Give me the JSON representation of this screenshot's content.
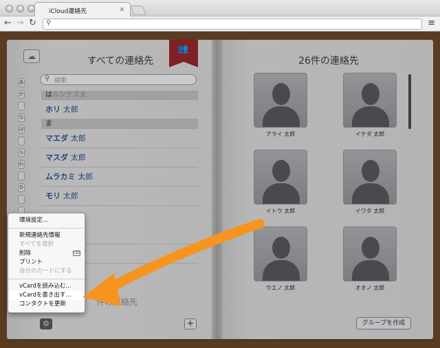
{
  "browser": {
    "tab_title": "iCloud連絡先"
  },
  "contacts_app": {
    "left_title": "すべての連絡先",
    "search_placeholder": "検索",
    "index_letters": [
      "あ",
      "か",
      "",
      "な",
      "は",
      "",
      "ら",
      "わ",
      "",
      "D",
      "",
      ""
    ],
    "sections": [
      {
        "header": "は",
        "header_rest": "ルンケス太",
        "contacts": [
          {
            "family": "ホリ",
            "given": "太郎"
          }
        ]
      },
      {
        "header": "ま",
        "header_rest": "",
        "contacts": [
          {
            "family": "マエダ",
            "given": "太郎"
          },
          {
            "family": "マスダ",
            "given": "太郎"
          },
          {
            "family": "ムラカミ",
            "given": "太郎"
          },
          {
            "family": "モリ",
            "given": "太郎"
          }
        ]
      }
    ],
    "footer_count": "件の連絡先",
    "right_title": "26件の連絡先",
    "cards": [
      {
        "name": "アライ 太郎"
      },
      {
        "name": "イケダ 太郎"
      },
      {
        "name": "イトウ 太郎"
      },
      {
        "name": "イワタ 太郎"
      },
      {
        "name": "ウエノ 太郎"
      },
      {
        "name": "オオノ 太郎"
      }
    ],
    "group_button": "グループを作成"
  },
  "context_menu": {
    "items": [
      {
        "label": "環境設定...",
        "enabled": true
      },
      {
        "label": "新規連絡先情報",
        "enabled": true
      },
      {
        "label": "すべてを選択",
        "enabled": false
      },
      {
        "label": "削除",
        "enabled": true
      },
      {
        "label": "プリント",
        "enabled": true
      },
      {
        "label": "自分のカードにする",
        "enabled": false
      },
      {
        "label": "vCardを読み込む...",
        "enabled": true
      },
      {
        "label": "vCardを書き出す...",
        "enabled": true,
        "highlighted": true
      },
      {
        "label": "コンタクトを更新",
        "enabled": true
      }
    ]
  },
  "colors": {
    "arrow": "#f7941d",
    "bookmark": "#9b1c1c",
    "contact_link": "#224c8a"
  }
}
